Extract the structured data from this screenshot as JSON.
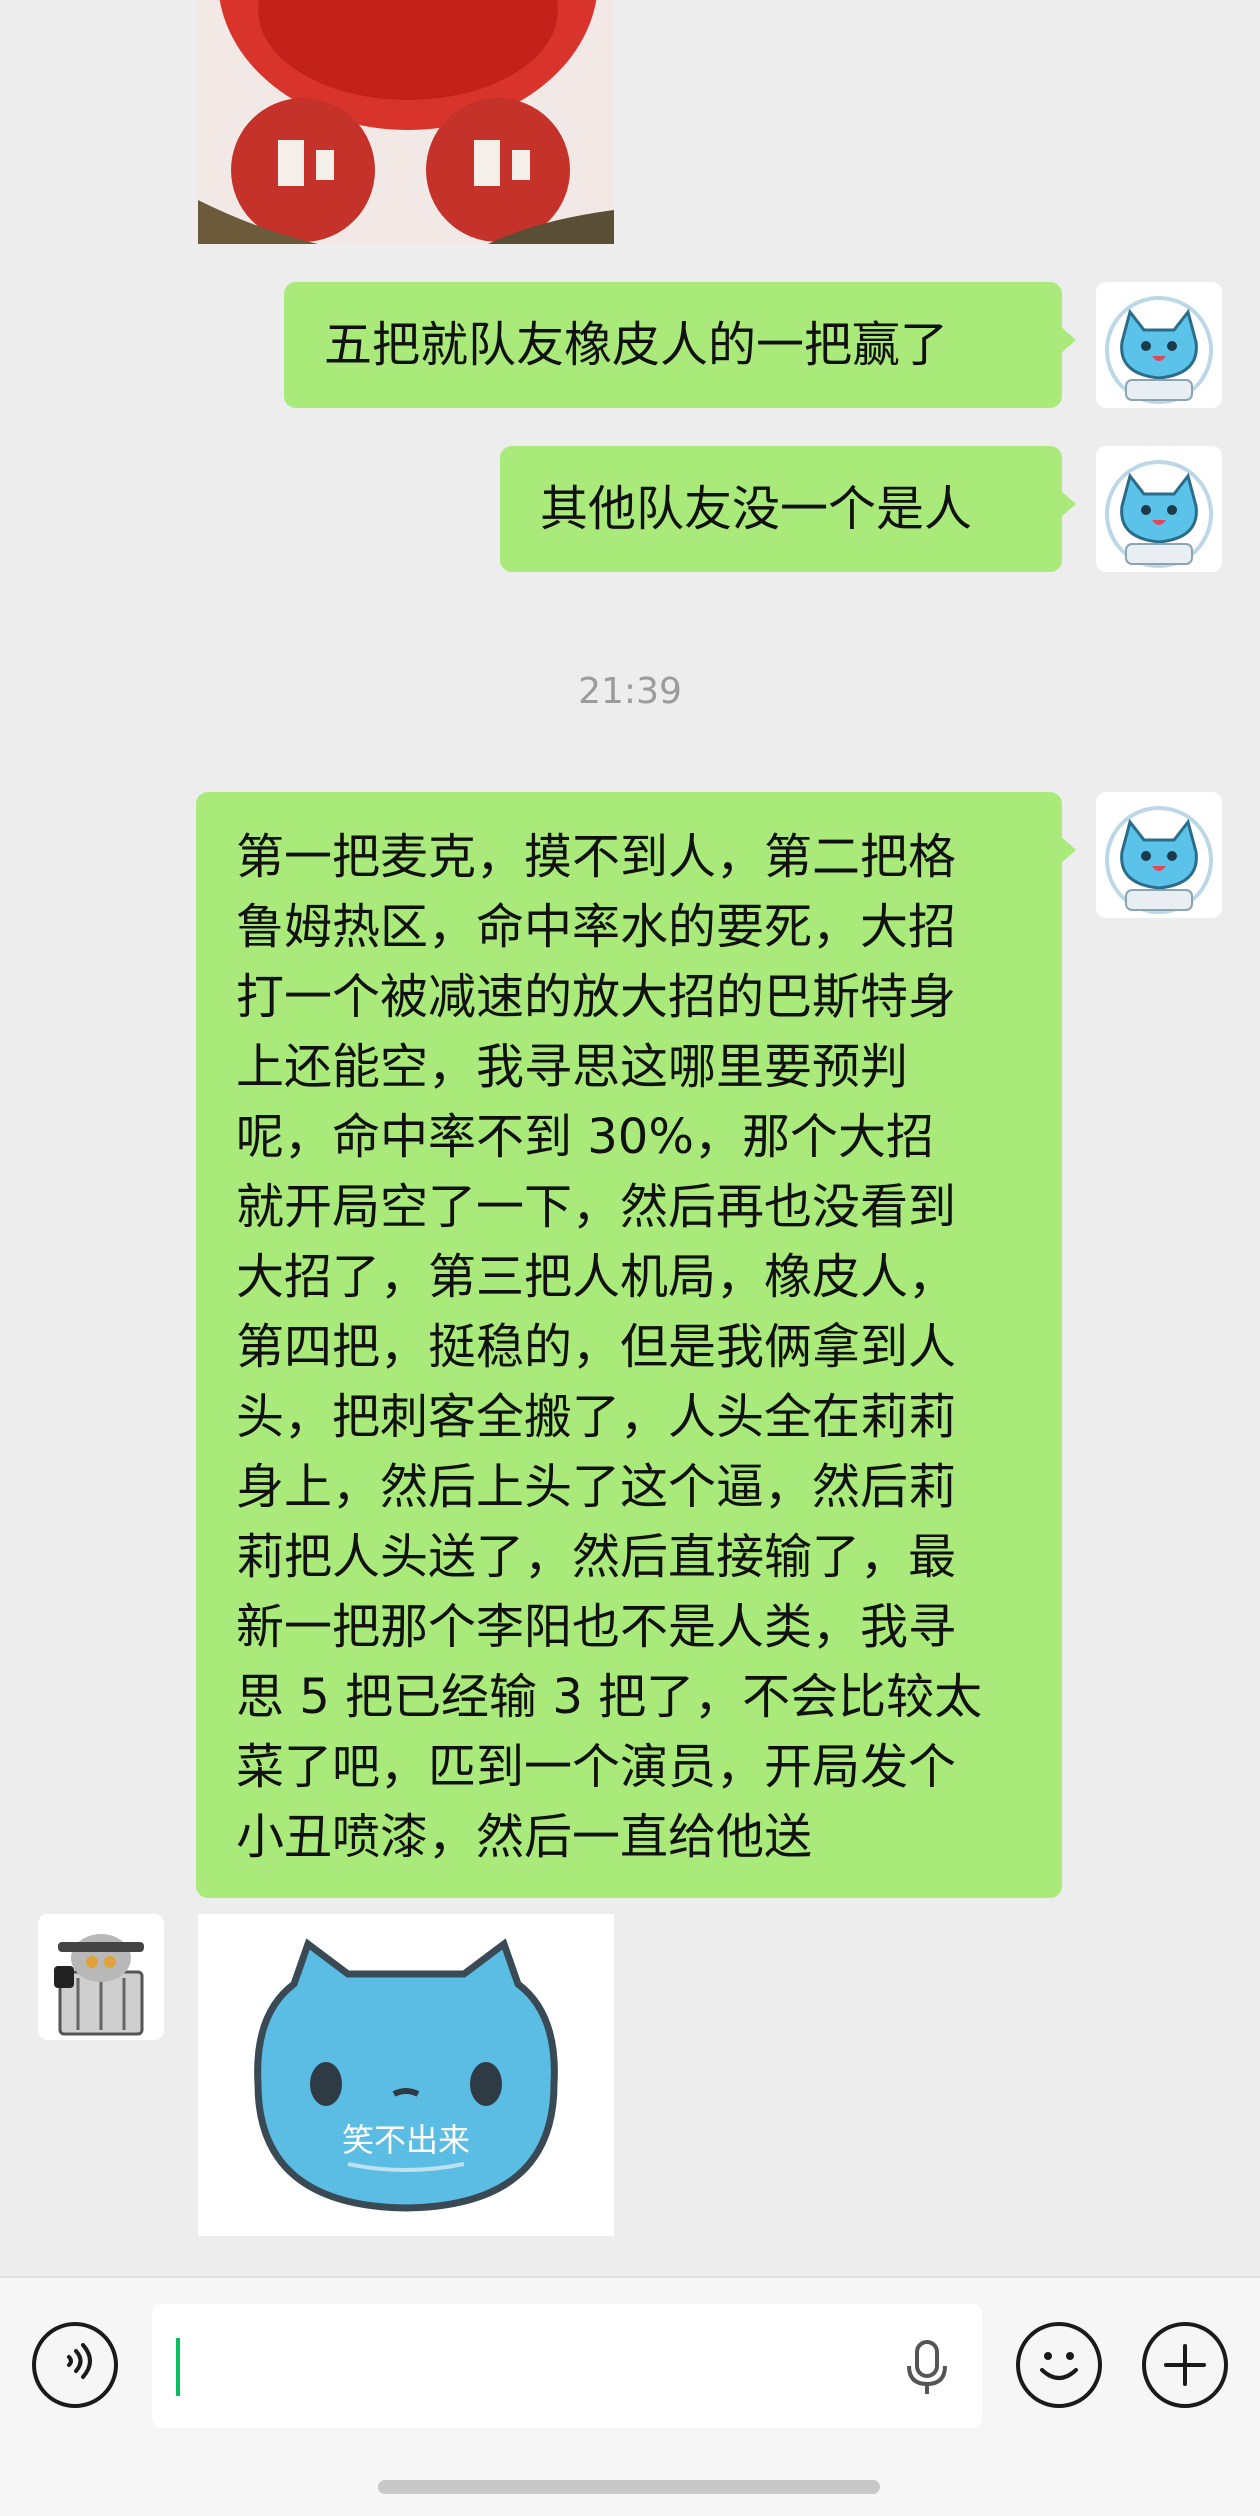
{
  "messages": [
    {
      "type": "sticker",
      "from": "other",
      "description": "red-faced crying sticker (cropped)"
    },
    {
      "type": "text",
      "from": "me",
      "text": "五把就队友橡皮人的一把赢了"
    },
    {
      "type": "text",
      "from": "me",
      "text": "其他队友没一个是人"
    },
    {
      "type": "timestamp",
      "text": "21:39"
    },
    {
      "type": "text",
      "from": "me",
      "lines": [
        "第一把麦克，摸不到人，第二把格",
        "鲁姆热区，命中率水的要死，大招",
        "打一个被减速的放大招的巴斯特身",
        "上还能空，我寻思这哪里要预判",
        "呢，命中率不到 30%，那个大招",
        "就开局空了一下，然后再也没看到",
        "大招了，第三把人机局，橡皮人，",
        "第四把，挺稳的，但是我俩拿到人",
        "头，把刺客全搬了，人头全在莉莉",
        "身上，然后上头了这个逼，然后莉",
        "莉把人头送了，然后直接输了，最",
        "新一把那个李阳也不是人类，我寻",
        "思 5 把已经输 3 把了，不会比较太",
        "菜了吧，匹到一个演员，开局发个",
        "小丑喷漆，然后一直给他送"
      ]
    },
    {
      "type": "sticker",
      "from": "other",
      "caption": "笑不出来"
    }
  ],
  "input_bar": {
    "voice_icon": "voice-icon",
    "text_value": "",
    "mic_icon": "mic-icon",
    "emoji_icon": "emoji-icon",
    "plus_icon": "plus-icon"
  },
  "colors": {
    "background": "#ededed",
    "my_bubble": "#a9ea7a",
    "timestamp_text": "#9b9b9b",
    "caret": "#07c160"
  }
}
